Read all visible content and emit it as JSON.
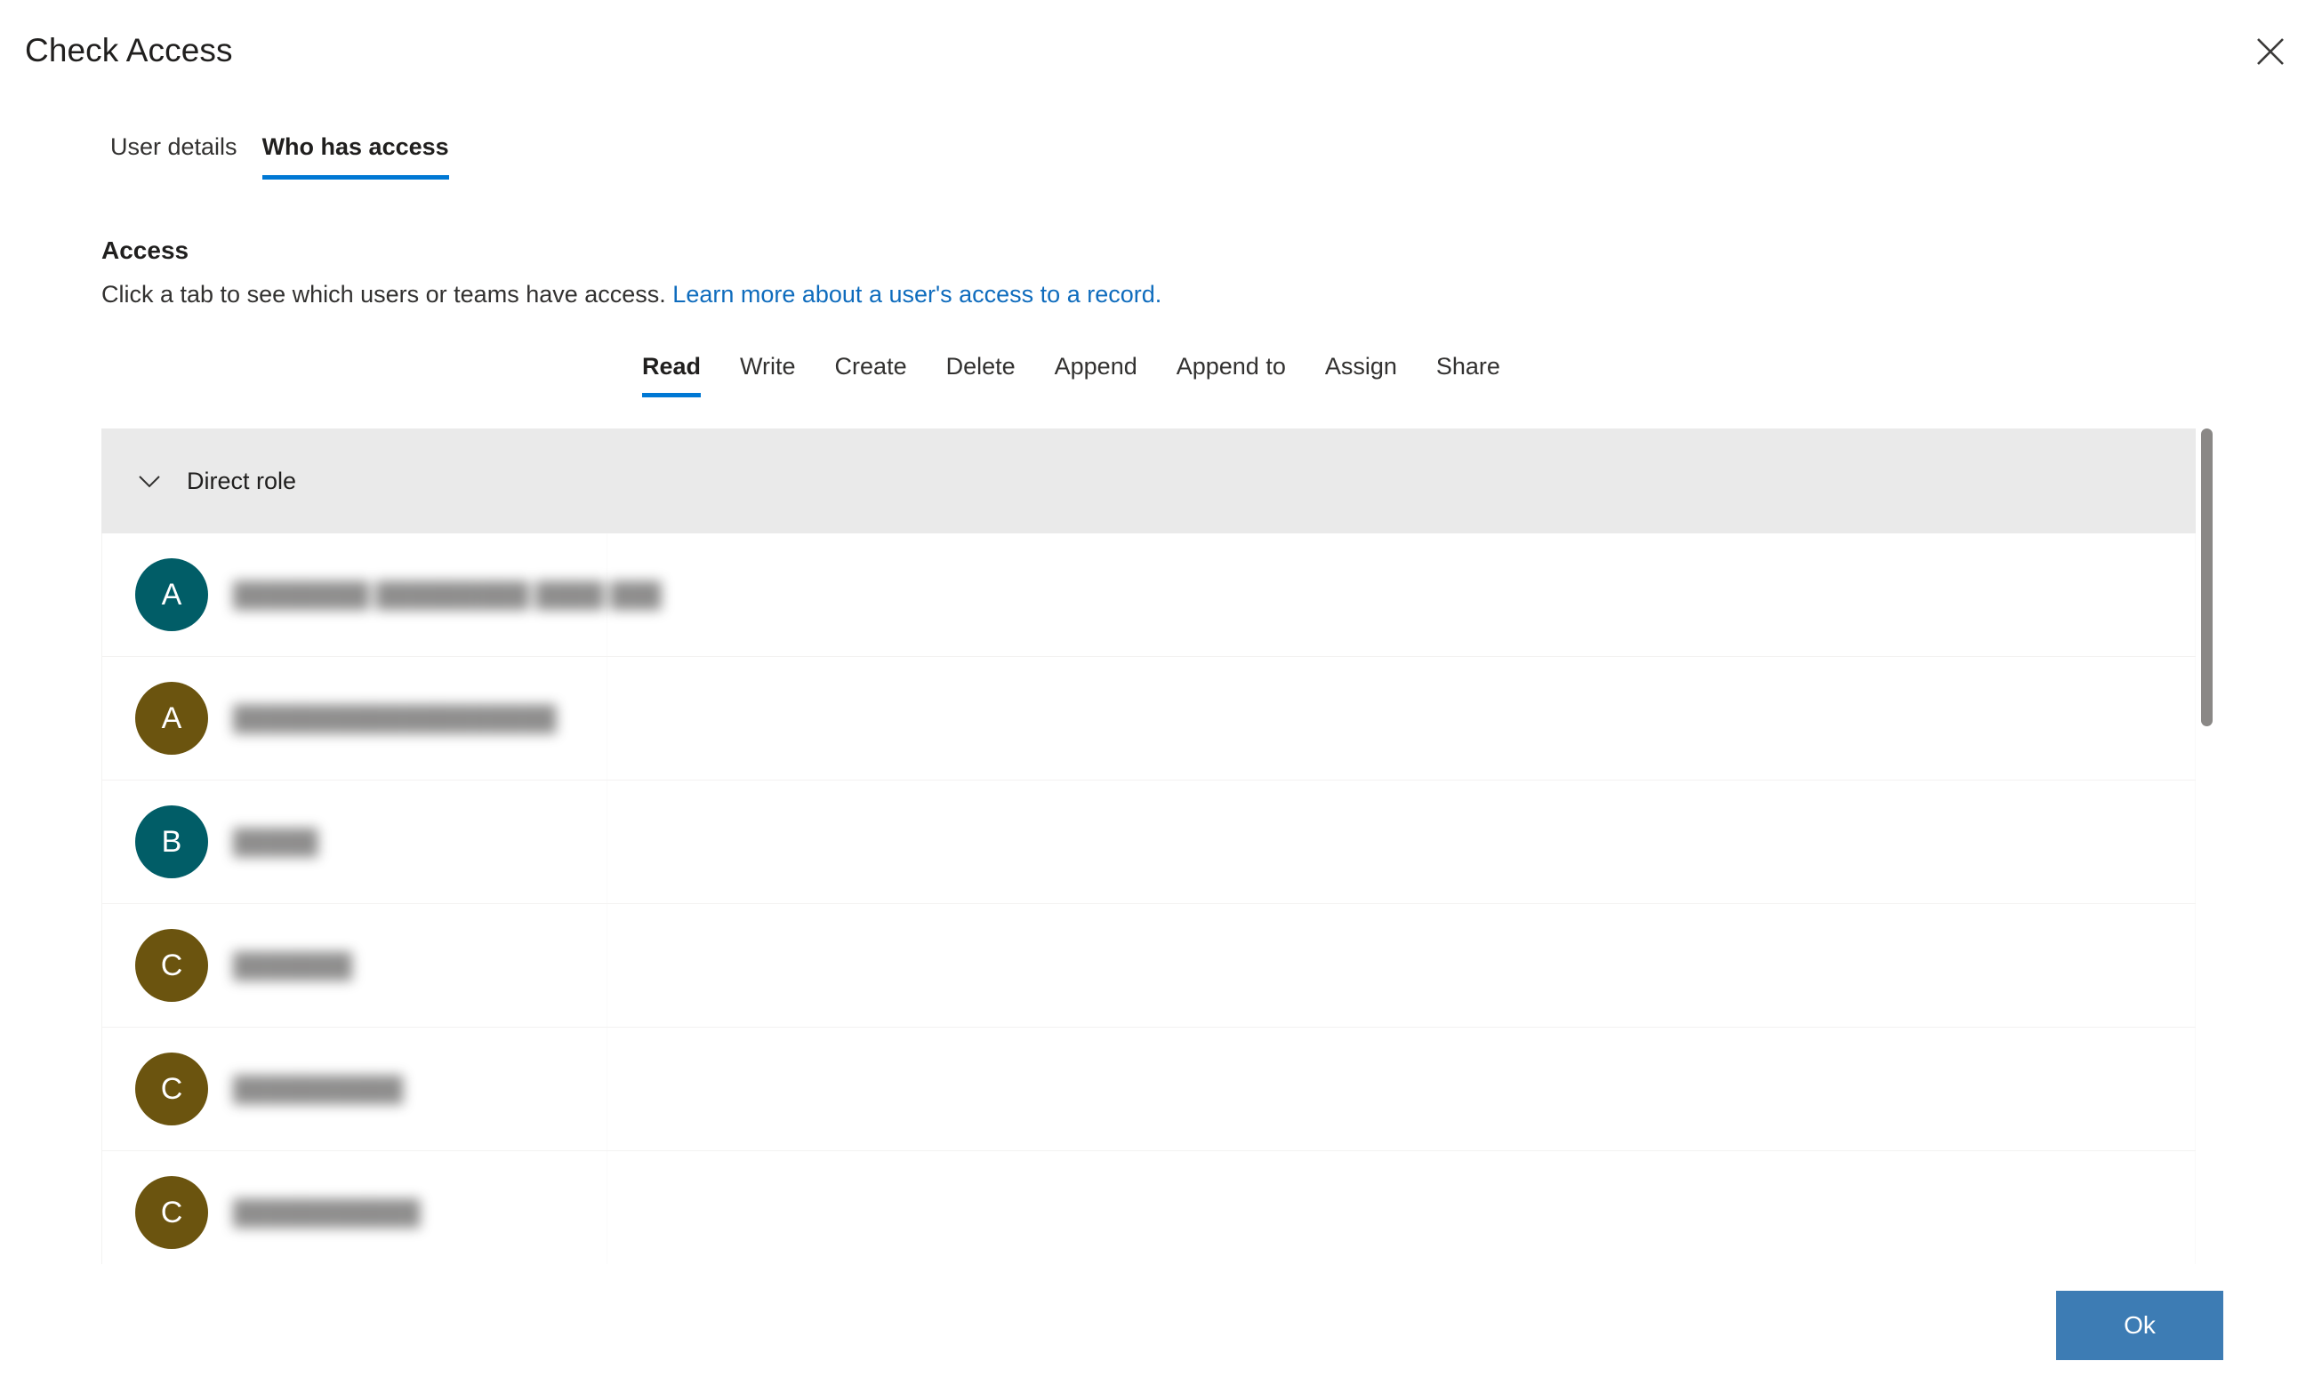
{
  "dialog": {
    "title": "Check Access",
    "close_label": "Close",
    "ok_label": "Ok"
  },
  "pivot": {
    "items": [
      {
        "label": "User details",
        "selected": false
      },
      {
        "label": "Who has access",
        "selected": true
      }
    ]
  },
  "access": {
    "heading": "Access",
    "description": "Click a tab to see which users or teams have access.",
    "link_text": "Learn more about a user's access to a record."
  },
  "privilege_tabs": {
    "items": [
      {
        "label": "Read",
        "selected": true
      },
      {
        "label": "Write",
        "selected": false
      },
      {
        "label": "Create",
        "selected": false
      },
      {
        "label": "Delete",
        "selected": false
      },
      {
        "label": "Append",
        "selected": false
      },
      {
        "label": "Append to",
        "selected": false
      },
      {
        "label": "Assign",
        "selected": false
      },
      {
        "label": "Share",
        "selected": false
      }
    ]
  },
  "list": {
    "group": {
      "label": "Direct role",
      "expanded": true,
      "chevron_icon": "chevron-down-icon"
    },
    "rows": [
      {
        "initial": "A",
        "avatar_color": "#015d67",
        "name": "████████ █████████ ████ ███"
      },
      {
        "initial": "A",
        "avatar_color": "#6b540f",
        "name": "███████████████████"
      },
      {
        "initial": "B",
        "avatar_color": "#015d67",
        "name": "█████"
      },
      {
        "initial": "C",
        "avatar_color": "#6b540f",
        "name": "███████"
      },
      {
        "initial": "C",
        "avatar_color": "#6b540f",
        "name": "██████████"
      },
      {
        "initial": "C",
        "avatar_color": "#6b540f",
        "name": "███████████"
      }
    ]
  },
  "colors": {
    "accent": "#0078d4",
    "link": "#0f6cbd",
    "group_header_bg": "#eaeaea",
    "ok_button_bg": "#3d7cb4",
    "avatar_teal": "#015d67",
    "avatar_gold": "#6b540f",
    "scrollbar_thumb": "#8a8886"
  }
}
